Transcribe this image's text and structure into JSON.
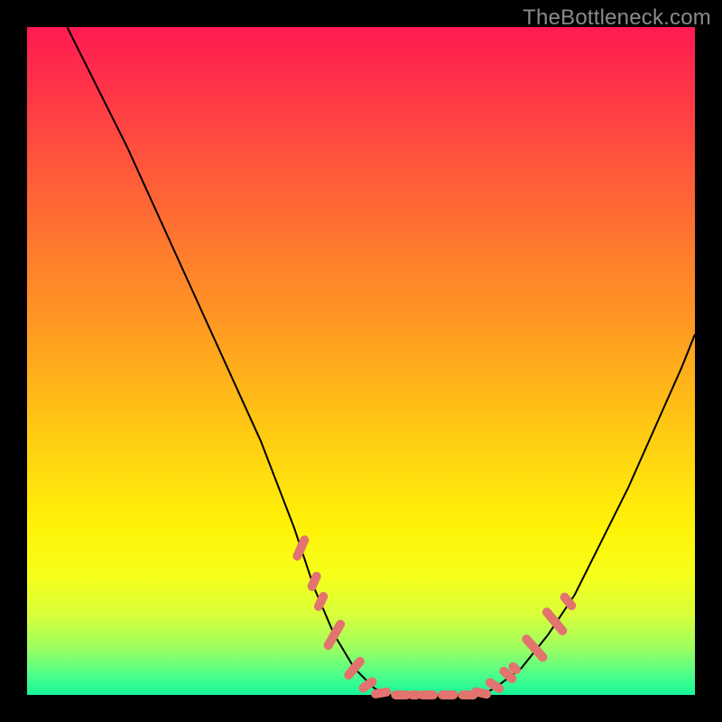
{
  "watermark": "TheBottleneck.com",
  "colors": {
    "background": "#000000",
    "gradient_top": "#ff1a52",
    "gradient_bottom": "#16f59a",
    "curve": "#000000",
    "marker": "#e2736e"
  },
  "chart_data": {
    "type": "line",
    "title": "",
    "xlabel": "",
    "ylabel": "",
    "xlim": [
      0,
      100
    ],
    "ylim": [
      0,
      100
    ],
    "grid": false,
    "legend": false,
    "annotations": [],
    "series": [
      {
        "name": "left-branch",
        "x": [
          6,
          10,
          15,
          20,
          25,
          30,
          35,
          40,
          43,
          46,
          49,
          52,
          54
        ],
        "y": [
          100,
          92,
          82,
          71,
          60,
          49,
          38,
          25,
          16,
          9,
          4,
          1,
          0
        ]
      },
      {
        "name": "valley-floor",
        "x": [
          54,
          56,
          58,
          60,
          62,
          64,
          66,
          68
        ],
        "y": [
          0,
          0,
          0,
          0,
          0,
          0,
          0,
          0
        ]
      },
      {
        "name": "right-branch",
        "x": [
          68,
          70,
          74,
          78,
          82,
          86,
          90,
          94,
          98,
          100
        ],
        "y": [
          0,
          1,
          4,
          9,
          15,
          23,
          31,
          40,
          49,
          54
        ]
      }
    ],
    "markers": {
      "name": "highlighted-points",
      "color": "#e2736e",
      "points": [
        {
          "x": 41,
          "y": 22,
          "len": 4,
          "angle": -66
        },
        {
          "x": 43,
          "y": 17,
          "len": 3,
          "angle": -66
        },
        {
          "x": 44,
          "y": 14,
          "len": 3,
          "angle": -64
        },
        {
          "x": 46,
          "y": 9,
          "len": 5,
          "angle": -60
        },
        {
          "x": 49,
          "y": 4,
          "len": 4,
          "angle": -50
        },
        {
          "x": 51,
          "y": 1.5,
          "len": 3,
          "angle": -35
        },
        {
          "x": 53,
          "y": 0.3,
          "len": 3,
          "angle": -10
        },
        {
          "x": 56,
          "y": 0,
          "len": 3,
          "angle": 0
        },
        {
          "x": 58,
          "y": 0,
          "len": 2,
          "angle": 0
        },
        {
          "x": 60,
          "y": 0,
          "len": 3,
          "angle": 0
        },
        {
          "x": 63,
          "y": 0,
          "len": 3,
          "angle": 0
        },
        {
          "x": 66,
          "y": 0,
          "len": 3,
          "angle": 0
        },
        {
          "x": 68,
          "y": 0.3,
          "len": 3,
          "angle": 12
        },
        {
          "x": 70,
          "y": 1.4,
          "len": 3,
          "angle": 32
        },
        {
          "x": 72,
          "y": 3,
          "len": 3,
          "angle": 42
        },
        {
          "x": 73,
          "y": 4,
          "len": 2,
          "angle": 45
        },
        {
          "x": 76,
          "y": 7,
          "len": 5,
          "angle": 48
        },
        {
          "x": 79,
          "y": 11,
          "len": 5,
          "angle": 50
        },
        {
          "x": 81,
          "y": 14,
          "len": 3,
          "angle": 51
        }
      ]
    }
  }
}
